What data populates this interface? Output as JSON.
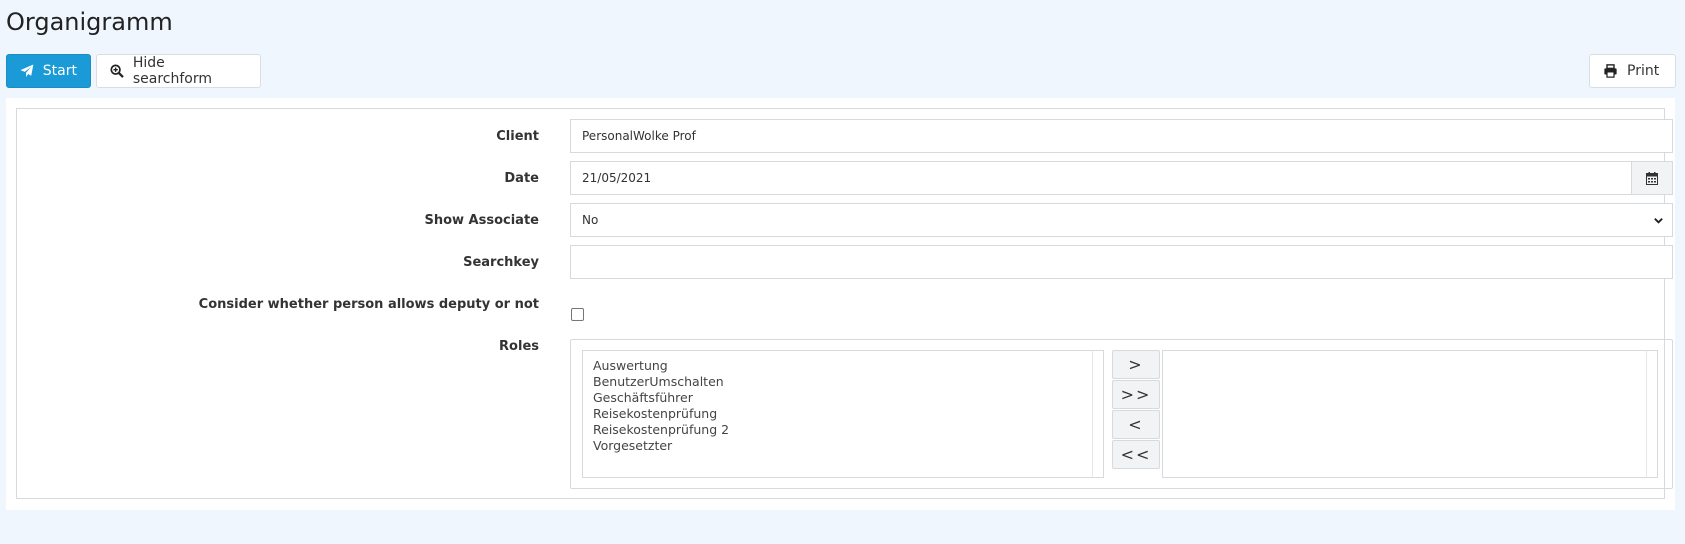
{
  "page": {
    "title": "Organigramm"
  },
  "toolbar": {
    "start_label": "Start",
    "hide_searchform_label": "Hide searchform",
    "print_label": "Print"
  },
  "form": {
    "client": {
      "label": "Client",
      "value": "PersonalWolke Prof"
    },
    "date": {
      "label": "Date",
      "value": "21/05/2021"
    },
    "show_associate": {
      "label": "Show Associate",
      "value": "No"
    },
    "searchkey": {
      "label": "Searchkey",
      "value": ""
    },
    "deputy": {
      "label": "Consider whether person allows deputy or not",
      "checked": false
    },
    "roles": {
      "label": "Roles",
      "available": [
        "Auswertung",
        "BenutzerUmschalten",
        "Geschäftsführer",
        "Reisekostenprüfung",
        "Reisekostenprüfung 2",
        "Vorgesetzter"
      ],
      "selected": [],
      "buttons": {
        "add": ">",
        "add_all": ">>",
        "remove": "<",
        "remove_all": "<<"
      }
    }
  },
  "colors": {
    "primary": "#1a9ad6",
    "background": "#eff6fd"
  }
}
